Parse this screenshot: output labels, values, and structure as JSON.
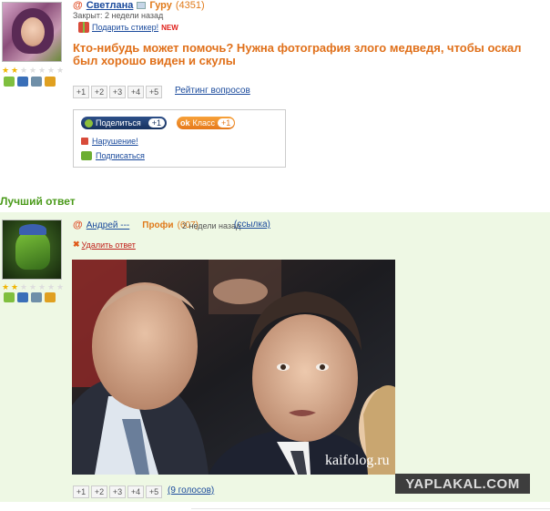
{
  "question": {
    "author": "Светлана",
    "level": "Гуру",
    "level_points": "(4351)",
    "closed": "Закрыт: 2 недели назад",
    "sticker_label": "Подарить стикер!",
    "new_badge": "NEW",
    "title": "Кто-нибудь может помочь? Нужна фотография злого медведя, чтобы оскал был хорошо виден и скулы",
    "votes": [
      "+1",
      "+2",
      "+3",
      "+4",
      "+5"
    ],
    "rating_link": "Рейтинг вопросов",
    "stars_total": 7,
    "stars_on": 2
  },
  "share_box": {
    "share_label": "Поделиться",
    "share_count": "+1",
    "ok_label": "Класс",
    "ok_count": "+1",
    "violation": "Нарушение!",
    "subscribe": "Подписаться"
  },
  "best_answer": {
    "header": "Лучший ответ",
    "author": "Андрей ---",
    "level": "Профи",
    "level_points": "(607)",
    "time": "2 недели назад",
    "link": "(ссылка)",
    "delete": "Удалить ответ",
    "watermark": "kaifolog.ru",
    "votes": [
      "+1",
      "+2",
      "+3",
      "+4",
      "+5"
    ],
    "votes_count": "(9 голосов)",
    "stars_total": 7,
    "stars_on": 2
  },
  "logo": "YAPLAKAL.COM",
  "colors": {
    "accent_orange": "#e0701a",
    "link_blue": "#1a4a9c",
    "best_green": "#4a9a1a",
    "answer_bg": "#eef8e4"
  }
}
